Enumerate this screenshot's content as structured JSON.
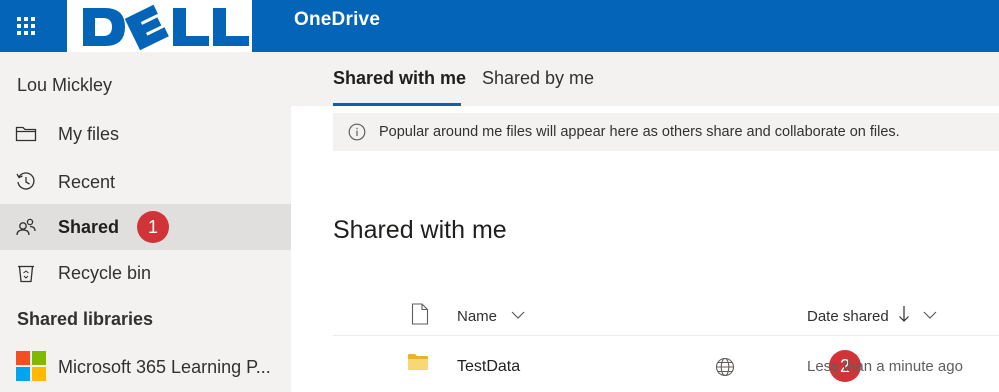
{
  "header": {
    "app_name": "OneDrive",
    "brand_logo": "DELL",
    "app_launcher_icon": "waffle-grid-icon",
    "colors": {
      "bar": "#0364b8",
      "text": "#ffffff"
    }
  },
  "sidebar": {
    "user_name": "Lou Mickley",
    "items": [
      {
        "label": "My files",
        "icon": "folder-icon",
        "selected": false
      },
      {
        "label": "Recent",
        "icon": "history-icon",
        "selected": false
      },
      {
        "label": "Shared",
        "icon": "people-icon",
        "selected": true,
        "badge": "1"
      },
      {
        "label": "Recycle bin",
        "icon": "recycle-bin-icon",
        "selected": false
      }
    ],
    "libraries_heading": "Shared libraries",
    "libraries": [
      {
        "label": "Microsoft 365 Learning P...",
        "icon": "microsoft-logo-icon"
      }
    ]
  },
  "main": {
    "tabs": [
      {
        "label": "Shared with me",
        "active": true
      },
      {
        "label": "Shared by me",
        "active": false
      }
    ],
    "info_banner": {
      "icon": "info-icon",
      "text": "Popular around me files will appear here as others share and collaborate on files."
    },
    "section_title": "Shared with me",
    "columns": {
      "name": "Name",
      "date_shared": "Date shared",
      "sort_direction": "descending"
    },
    "files": [
      {
        "name": "TestData",
        "type": "folder",
        "sharing": "globe-icon",
        "date_shared": "Less than a minute ago",
        "badge": "2"
      }
    ],
    "colors": {
      "accent": "#0364b8",
      "badge": "#d13438",
      "folder": "#f8d775"
    }
  }
}
